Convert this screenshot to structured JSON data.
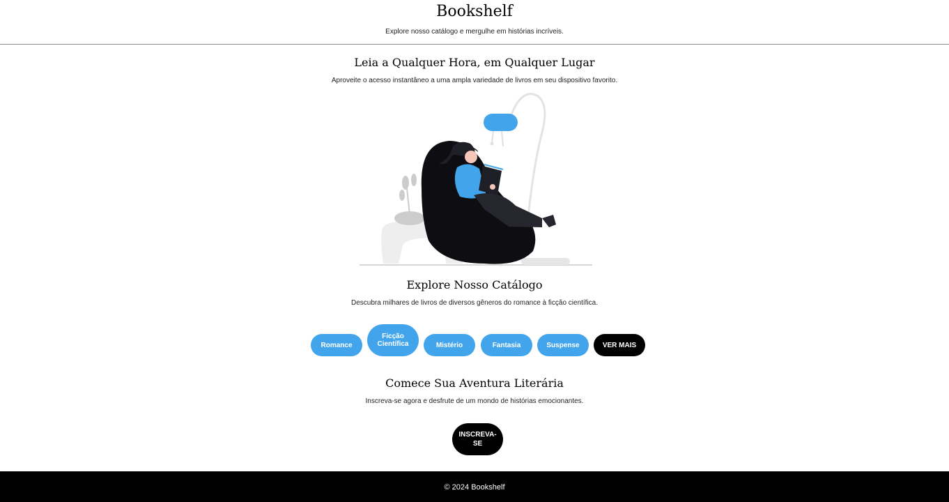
{
  "header": {
    "brand": "Bookshelf",
    "tagline": "Explore nosso catálogo e mergulhe em histórias incríveis."
  },
  "hero": {
    "title": "Leia a Qualquer Hora, em Qualquer Lugar",
    "text": "Aproveite o acesso instantâneo a uma ampla variedade de livros em seu dispositivo favorito.",
    "illustration_icon": "person-reading-in-chair-illustration"
  },
  "catalog": {
    "title": "Explore Nosso Catálogo",
    "text": "Descubra milhares de livros de diversos gêneros do romance à ficção científica.",
    "genres": [
      {
        "label": "Romance"
      },
      {
        "label": "Ficção Científica"
      },
      {
        "label": "Mistério"
      },
      {
        "label": "Fantasia"
      },
      {
        "label": "Suspense"
      }
    ],
    "more_label": "VER MAIS"
  },
  "signup": {
    "title": "Comece Sua Aventura Literária",
    "text": "Inscreva-se agora e desfrute de um mondo de histórias emocionantes.",
    "button_label": "INSCREVA-SE"
  },
  "footer": {
    "text": "© 2024 Bookshelf"
  },
  "colors": {
    "accent": "#42a5ec",
    "dark": "#000000",
    "background": "#ffffff"
  }
}
